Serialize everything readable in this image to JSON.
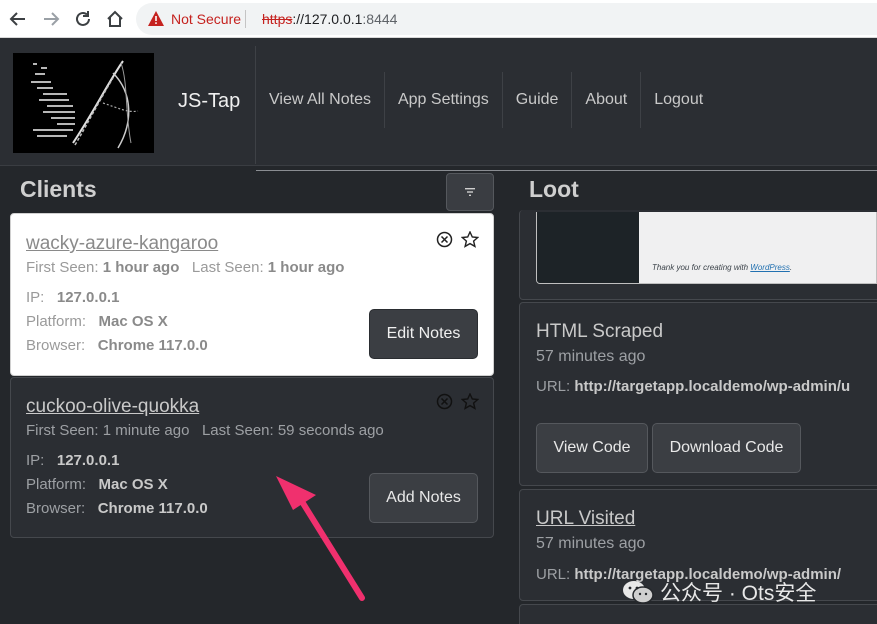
{
  "browser": {
    "security_label": "Not Secure",
    "url_scheme": "https",
    "url_host": "://127.0.0.1",
    "url_port": ":8444"
  },
  "header": {
    "brand": "JS-Tap",
    "nav": [
      "View All Notes",
      "App Settings",
      "Guide",
      "About",
      "Logout"
    ]
  },
  "clients": {
    "title": "Clients",
    "items": [
      {
        "name": "wacky-azure-kangaroo",
        "first_seen_label": "First Seen:",
        "first_seen": "1 hour ago",
        "last_seen_label": "Last Seen:",
        "last_seen": "1 hour ago",
        "ip_label": "IP:",
        "ip": "127.0.0.1",
        "platform_label": "Platform:",
        "platform": "Mac OS X",
        "browser_label": "Browser:",
        "browser": "Chrome 117.0.0",
        "button": "Edit Notes"
      },
      {
        "name": "cuckoo-olive-quokka",
        "first_seen_label": "First Seen:",
        "first_seen": "1 minute ago",
        "last_seen_label": "Last Seen:",
        "last_seen": "59 seconds ago",
        "ip_label": "IP:",
        "ip": "127.0.0.1",
        "platform_label": "Platform:",
        "platform": "Mac OS X",
        "browser_label": "Browser:",
        "browser": "Chrome 117.0.0",
        "button": "Add Notes"
      }
    ]
  },
  "loot": {
    "title": "Loot",
    "thumbnail_text": "Thank you for creating with",
    "thumbnail_link": "WordPress",
    "items": [
      {
        "title": "HTML Scraped",
        "time": "57 minutes ago",
        "url_label": "URL:",
        "url": "http://targetapp.localdemo/wp-admin/u",
        "buttons": [
          "View Code",
          "Download Code"
        ]
      },
      {
        "title": "URL Visited",
        "time": "57 minutes ago",
        "url_label": "URL:",
        "url": "http://targetapp.localdemo/wp-admin/"
      }
    ]
  },
  "watermark": "公众号 · Ots安全",
  "colors": {
    "arrow": "#f0306e",
    "security_warning": "#c5221f"
  }
}
